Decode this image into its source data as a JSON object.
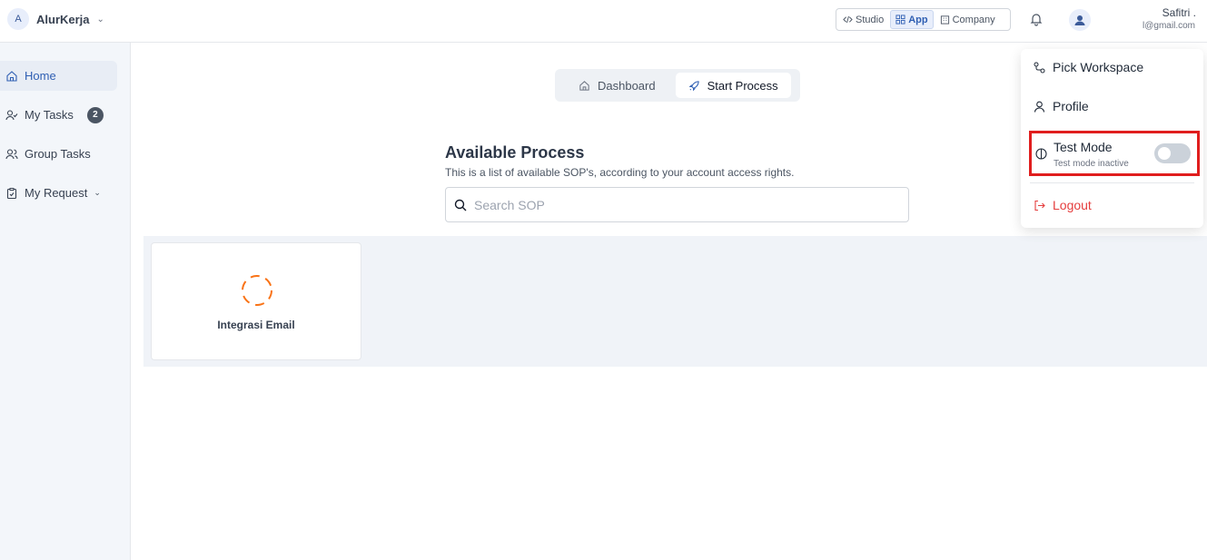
{
  "workspace": {
    "initial": "A",
    "name": "AlurKerja"
  },
  "switcher": {
    "studio": "Studio",
    "app": "App",
    "company": "Company"
  },
  "user": {
    "name": "Safitri .",
    "email": "l@gmail.com"
  },
  "sidebar": {
    "items": [
      {
        "label": "Home"
      },
      {
        "label": "My Tasks",
        "badge": "2"
      },
      {
        "label": "Group Tasks"
      },
      {
        "label": "My Request"
      }
    ]
  },
  "tabs": {
    "dashboard": "Dashboard",
    "start_process": "Start Process"
  },
  "section": {
    "title": "Available Process",
    "subtitle": "This is a list of available SOP's, according to your account access rights.",
    "search_placeholder": "Search SOP"
  },
  "processes": [
    {
      "label": "Integrasi Email"
    }
  ],
  "dropdown": {
    "pick_workspace": "Pick Workspace",
    "profile": "Profile",
    "test_mode": "Test Mode",
    "test_mode_status": "Test mode inactive",
    "test_mode_on": false,
    "logout": "Logout"
  },
  "colors": {
    "accent": "#2f5fb3",
    "highlight": "#e01e1e",
    "logout": "#e53e3e",
    "process_icon": "#f97316"
  }
}
